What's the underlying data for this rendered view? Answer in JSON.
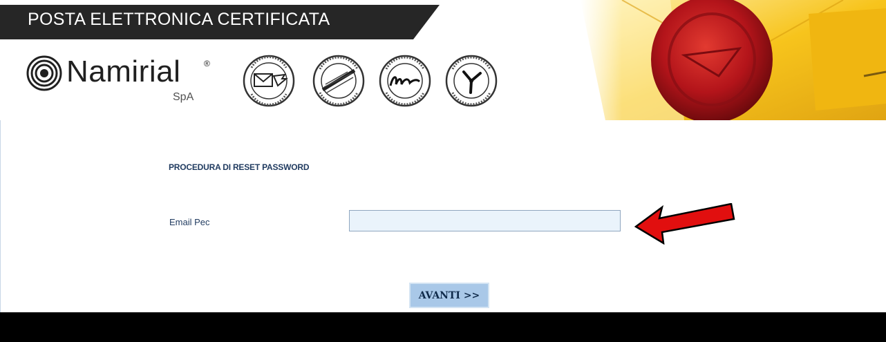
{
  "header": {
    "title": "POSTA ELETTRONICA CERTIFICATA",
    "logo": {
      "name": "Namirial",
      "registered_mark": "®",
      "suffix": "SpA"
    },
    "seals": [
      {
        "icon": "secure-mail-seal-icon",
        "text": "SICUREZZA POSTALE · POSTA ELETTRONICA CERTIFICATA"
      },
      {
        "icon": "firma-certa-ca-seal-icon",
        "text": "FIRMA CERTA · CERTIFICATION AUTHORITY"
      },
      {
        "icon": "firma-certa-grafometrica-seal-icon",
        "text": "FIRMA CERTA · GRAFOMETRICA"
      },
      {
        "icon": "firma-certa-time-stamping-seal-icon",
        "text": "FIRMA CERTA · TIME STAMPING"
      }
    ],
    "envelope_icon": "wax-sealed-envelope-icon"
  },
  "form": {
    "heading": "PROCEDURA DI RESET PASSWORD",
    "email_label": "Email Pec",
    "email_value": "",
    "email_placeholder": "",
    "submit_label": "AVANTI >>",
    "arrow_icon": "red-arrow-pointer-icon"
  },
  "colors": {
    "title_bar": "#262626",
    "heading_text": "#1f3a5f",
    "input_bg": "#eaf3fb",
    "input_border": "#8fa6bf",
    "button_bg": "#a9c8e8",
    "arrow_red": "#e10f0f",
    "envelope_yellow": "#f5c21a",
    "wax_red": "#b3141a",
    "footer": "#000000"
  }
}
